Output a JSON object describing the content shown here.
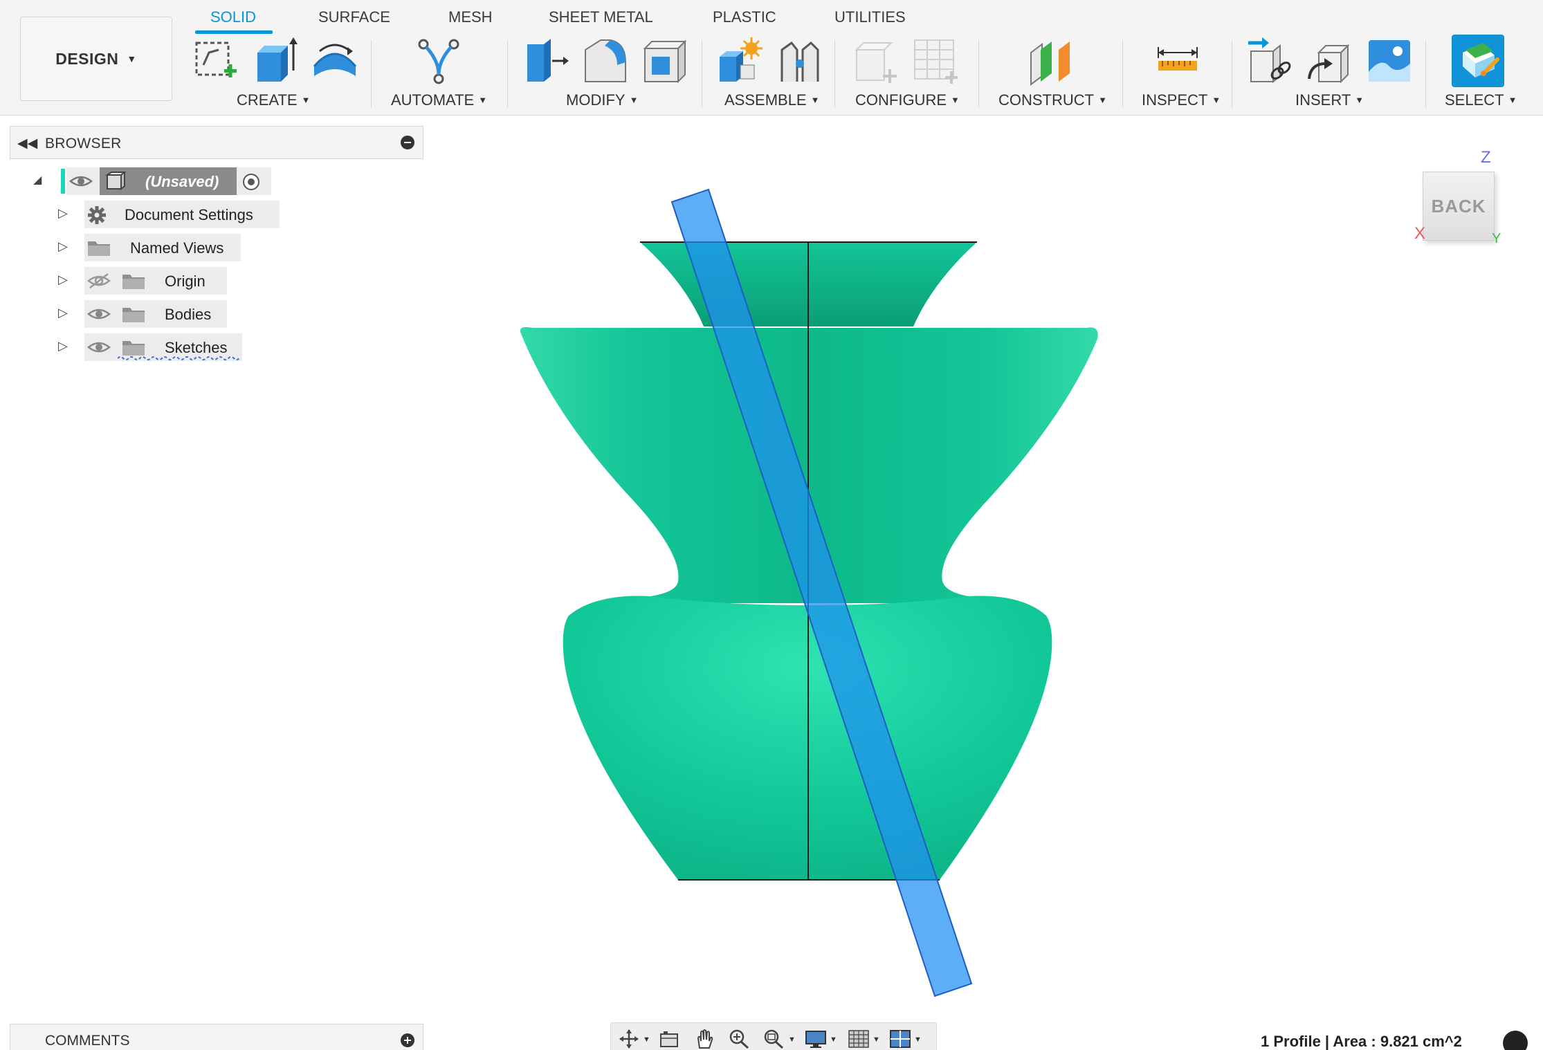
{
  "workspace": {
    "label": "DESIGN"
  },
  "tabs": [
    {
      "label": "SOLID",
      "active": true
    },
    {
      "label": "SURFACE",
      "active": false
    },
    {
      "label": "MESH",
      "active": false
    },
    {
      "label": "SHEET METAL",
      "active": false
    },
    {
      "label": "PLASTIC",
      "active": false
    },
    {
      "label": "UTILITIES",
      "active": false
    }
  ],
  "groups": [
    {
      "label": "CREATE",
      "icons": [
        "create-sketch-icon",
        "extrude-icon",
        "revolve-icon"
      ]
    },
    {
      "label": "AUTOMATE",
      "icons": [
        "automate-icon"
      ]
    },
    {
      "label": "MODIFY",
      "icons": [
        "press-pull-icon",
        "fillet-icon",
        "shell-icon"
      ]
    },
    {
      "label": "ASSEMBLE",
      "icons": [
        "new-component-icon",
        "joint-icon"
      ]
    },
    {
      "label": "CONFIGURE",
      "icons": [
        "configure-icon",
        "table-icon"
      ]
    },
    {
      "label": "CONSTRUCT",
      "icons": [
        "offset-plane-icon"
      ]
    },
    {
      "label": "INSPECT",
      "icons": [
        "measure-icon"
      ]
    },
    {
      "label": "INSERT",
      "icons": [
        "insert-derive-icon",
        "insert-mesh-icon",
        "canvas-icon"
      ]
    },
    {
      "label": "SELECT",
      "icons": [
        "select-icon"
      ]
    }
  ],
  "browser": {
    "title": "BROWSER",
    "root": {
      "label": "(Unsaved)"
    },
    "items": [
      {
        "label": "Document Settings",
        "icon": "gear-icon"
      },
      {
        "label": "Named Views",
        "icon": "folder-icon"
      },
      {
        "label": "Origin",
        "icon": "folder-icon",
        "visibility": "hidden"
      },
      {
        "label": "Bodies",
        "icon": "folder-icon",
        "visibility": "visible"
      },
      {
        "label": "Sketches",
        "icon": "folder-icon",
        "visibility": "visible"
      }
    ]
  },
  "comments": {
    "title": "COMMENTS"
  },
  "viewcube": {
    "face": "BACK",
    "axes": {
      "z": "Z",
      "x": "X",
      "y": "Y"
    }
  },
  "status": {
    "text": "1 Profile | Area : 9.821 cm^2"
  },
  "colors": {
    "accent": "#0696d7",
    "body": "#1ccf9f",
    "profile_band": "#1f8ff0",
    "background": "#ffffff"
  }
}
